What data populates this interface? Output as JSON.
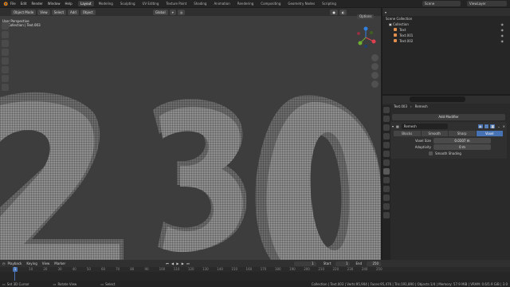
{
  "topbar": {
    "menus": [
      "File",
      "Edit",
      "Render",
      "Window",
      "Help"
    ],
    "tabs": [
      "Layout",
      "Modeling",
      "Sculpting",
      "UV Editing",
      "Texture Paint",
      "Shading",
      "Animation",
      "Rendering",
      "Compositing",
      "Geometry Nodes",
      "Scripting"
    ],
    "active_tab": "Layout",
    "scene": "Scene",
    "view_layer": "ViewLayer"
  },
  "viewport": {
    "mode": "Object Mode",
    "menus": [
      "View",
      "Select",
      "Add",
      "Object"
    ],
    "transform_orientation": "Global",
    "options_label": "Options",
    "info_line1": "User Perspective",
    "info_line2": "(1) Collection | Text.003",
    "text_visible": "230"
  },
  "outliner": {
    "title": "Scene Collection",
    "items": [
      {
        "label": "Collection",
        "indent": 0
      },
      {
        "label": "Text",
        "indent": 1
      },
      {
        "label": "Text.001",
        "indent": 1
      },
      {
        "label": "Text.002",
        "indent": 1
      }
    ]
  },
  "properties": {
    "breadcrumb_object": "Text.003",
    "breadcrumb_modifier": "Remesh",
    "add_modifier": "Add Modifier",
    "modifier_name": "Remesh",
    "modes": [
      "Blocks",
      "Smooth",
      "Sharp",
      "Voxel"
    ],
    "active_mode": "Voxel",
    "voxel_size_label": "Voxel Size",
    "voxel_size_value": "0.0107 m",
    "adaptivity_label": "Adaptivity",
    "adaptivity_value": "0 m",
    "smooth_shading_label": "Smooth Shading"
  },
  "timeline": {
    "menus": [
      "Playback",
      "Keying",
      "View",
      "Marker"
    ],
    "current_frame": "1",
    "start_label": "Start",
    "start": "1",
    "end_label": "End",
    "end": "250",
    "ticks": [
      "0",
      "10",
      "20",
      "30",
      "40",
      "50",
      "60",
      "70",
      "80",
      "90",
      "100",
      "110",
      "120",
      "130",
      "140",
      "150",
      "160",
      "170",
      "180",
      "190",
      "200",
      "210",
      "220",
      "230",
      "240",
      "250"
    ]
  },
  "statusbar": {
    "left1": "Set 3D Cursor",
    "left2": "Rotate View",
    "left3": "Select",
    "right": "Collection | Text.003 | Verts:95,904 | Faces:95,476 | Tris:191,890 | Objects:1/4 | Memory: 57.9 MiB | VRAM: 0.6/5.9 GiB | 3.0"
  },
  "colors": {
    "accent": "#4772b3",
    "viewport_bg": "#3d3d3d",
    "mesh_fill": "#8c8c8c",
    "wire": "#1a1a1a"
  }
}
